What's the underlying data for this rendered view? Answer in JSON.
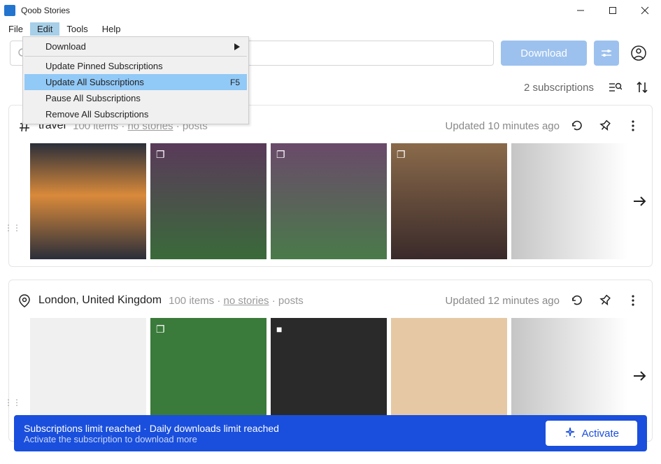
{
  "window": {
    "title": "Qoob Stories"
  },
  "menubar": {
    "file": "File",
    "edit": "Edit",
    "tools": "Tools",
    "help": "Help"
  },
  "edit_menu": {
    "download": "Download",
    "update_pinned": "Update Pinned Subscriptions",
    "update_all": "Update All Subscriptions",
    "update_all_sc": "F5",
    "pause_all": "Pause All Subscriptions",
    "remove_all": "Remove All Subscriptions"
  },
  "toolbar": {
    "download": "Download"
  },
  "subs": {
    "count_text": "2 subscriptions"
  },
  "feeds": [
    {
      "icon": "hash",
      "title": "travel",
      "items": "100 items",
      "no_stories": "no stories",
      "posts": "posts",
      "updated": "Updated 10 minutes ago"
    },
    {
      "icon": "pin",
      "title": "London, United Kingdom",
      "items": "100 items",
      "no_stories": "no stories",
      "posts": "posts",
      "updated": "Updated 12 minutes ago"
    }
  ],
  "banner": {
    "line1": "Subscriptions limit reached · Daily downloads limit reached",
    "line2": "Activate the subscription to download more",
    "activate": "Activate"
  }
}
